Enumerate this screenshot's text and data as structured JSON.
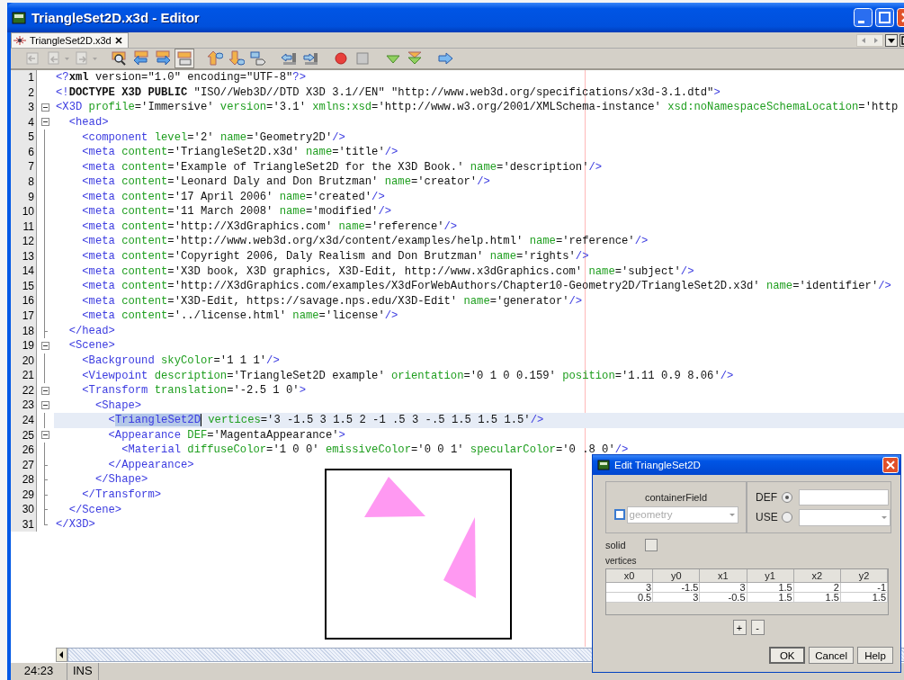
{
  "window": {
    "title": "TriangleSet2D.x3d - Editor"
  },
  "editor_tabs": [
    {
      "label": "TriangleSet2D.x3d",
      "selected": true
    }
  ],
  "toolbar": [
    {
      "disabled": true,
      "pressed": false
    },
    {
      "disabled": true,
      "pressed": false
    },
    {
      "disabled": true,
      "pressed": false
    },
    {
      "disabled": false,
      "pressed": false
    },
    {
      "disabled": false,
      "pressed": false
    },
    {
      "disabled": false,
      "pressed": false
    },
    {
      "disabled": false,
      "pressed": true
    },
    {
      "disabled": false,
      "pressed": false
    },
    {
      "disabled": false,
      "pressed": false
    },
    {
      "disabled": false,
      "pressed": false
    },
    {
      "disabled": false,
      "pressed": false
    },
    {
      "disabled": false,
      "pressed": false
    },
    {
      "disabled": false,
      "pressed": false
    },
    {
      "disabled": false,
      "pressed": false
    },
    {
      "disabled": false,
      "pressed": false
    },
    {
      "disabled": false,
      "pressed": false
    },
    {
      "disabled": false,
      "pressed": false
    }
  ],
  "editor": {
    "lines": [
      {
        "number": "1",
        "kind": "plain",
        "highlighted": false,
        "tokens": [
          {
            "kind": "tag",
            "text": "<?"
          },
          {
            "kind": "keyword",
            "text": "xml"
          },
          {
            "kind": "text",
            "text": " version=\"1.0\" encoding=\"UTF-8\""
          },
          {
            "kind": "tag",
            "text": "?>"
          }
        ]
      },
      {
        "number": "2",
        "kind": "plain",
        "highlighted": false,
        "tokens": [
          {
            "kind": "tag",
            "text": "<!"
          },
          {
            "kind": "keyword",
            "text": "DOCTYPE X3D PUBLIC"
          },
          {
            "kind": "text",
            "text": " \"ISO//Web3D//DTD X3D 3.1//EN\" \"http://www.web3d.org/specifications/x3d-3.1.dtd\""
          },
          {
            "kind": "tag",
            "text": ">"
          }
        ]
      },
      {
        "number": "3",
        "kind": "opener",
        "highlighted": false,
        "tokens": [
          {
            "kind": "tag",
            "text": "<X3D "
          },
          {
            "kind": "attr",
            "text": "profile"
          },
          {
            "kind": "text",
            "text": "='Immersive' "
          },
          {
            "kind": "attr",
            "text": "version"
          },
          {
            "kind": "text",
            "text": "='3.1' "
          },
          {
            "kind": "attr",
            "text": "xmlns:xsd"
          },
          {
            "kind": "text",
            "text": "='http://www.w3.org/2001/XMLSchema-instance' "
          },
          {
            "kind": "attr",
            "text": "xsd:noNamespaceSchemaLocation"
          },
          {
            "kind": "text",
            "text": "='http"
          }
        ]
      },
      {
        "number": "4",
        "kind": "opener",
        "highlighted": false,
        "tokens": [
          {
            "kind": "tag",
            "text": "<head>"
          }
        ]
      },
      {
        "number": "5",
        "kind": "inner",
        "highlighted": false,
        "tokens": [
          {
            "kind": "tag",
            "text": "<component "
          },
          {
            "kind": "attr",
            "text": "level"
          },
          {
            "kind": "text",
            "text": "='2' "
          },
          {
            "kind": "attr",
            "text": "name"
          },
          {
            "kind": "text",
            "text": "='Geometry2D'"
          },
          {
            "kind": "tag",
            "text": "/>"
          }
        ]
      },
      {
        "number": "6",
        "kind": "inner",
        "highlighted": false,
        "tokens": [
          {
            "kind": "tag",
            "text": "<meta "
          },
          {
            "kind": "attr",
            "text": "content"
          },
          {
            "kind": "text",
            "text": "='TriangleSet2D.x3d' "
          },
          {
            "kind": "attr",
            "text": "name"
          },
          {
            "kind": "text",
            "text": "='title'"
          },
          {
            "kind": "tag",
            "text": "/>"
          }
        ]
      },
      {
        "number": "7",
        "kind": "inner",
        "highlighted": false,
        "tokens": [
          {
            "kind": "tag",
            "text": "<meta "
          },
          {
            "kind": "attr",
            "text": "content"
          },
          {
            "kind": "text",
            "text": "='Example of TriangleSet2D for the X3D Book.' "
          },
          {
            "kind": "attr",
            "text": "name"
          },
          {
            "kind": "text",
            "text": "='description'"
          },
          {
            "kind": "tag",
            "text": "/>"
          }
        ]
      },
      {
        "number": "8",
        "kind": "inner",
        "highlighted": false,
        "tokens": [
          {
            "kind": "tag",
            "text": "<meta "
          },
          {
            "kind": "attr",
            "text": "content"
          },
          {
            "kind": "text",
            "text": "='Leonard Daly and Don Brutzman' "
          },
          {
            "kind": "attr",
            "text": "name"
          },
          {
            "kind": "text",
            "text": "='creator'"
          },
          {
            "kind": "tag",
            "text": "/>"
          }
        ]
      },
      {
        "number": "9",
        "kind": "inner",
        "highlighted": false,
        "tokens": [
          {
            "kind": "tag",
            "text": "<meta "
          },
          {
            "kind": "attr",
            "text": "content"
          },
          {
            "kind": "text",
            "text": "='17 April 2006' "
          },
          {
            "kind": "attr",
            "text": "name"
          },
          {
            "kind": "text",
            "text": "='created'"
          },
          {
            "kind": "tag",
            "text": "/>"
          }
        ]
      },
      {
        "number": "10",
        "kind": "inner",
        "highlighted": false,
        "tokens": [
          {
            "kind": "tag",
            "text": "<meta "
          },
          {
            "kind": "attr",
            "text": "content"
          },
          {
            "kind": "text",
            "text": "='11 March 2008' "
          },
          {
            "kind": "attr",
            "text": "name"
          },
          {
            "kind": "text",
            "text": "='modified'"
          },
          {
            "kind": "tag",
            "text": "/>"
          }
        ]
      },
      {
        "number": "11",
        "kind": "inner",
        "highlighted": false,
        "tokens": [
          {
            "kind": "tag",
            "text": "<meta "
          },
          {
            "kind": "attr",
            "text": "content"
          },
          {
            "kind": "text",
            "text": "='http://X3dGraphics.com' "
          },
          {
            "kind": "attr",
            "text": "name"
          },
          {
            "kind": "text",
            "text": "='reference'"
          },
          {
            "kind": "tag",
            "text": "/>"
          }
        ]
      },
      {
        "number": "12",
        "kind": "inner",
        "highlighted": false,
        "tokens": [
          {
            "kind": "tag",
            "text": "<meta "
          },
          {
            "kind": "attr",
            "text": "content"
          },
          {
            "kind": "text",
            "text": "='http://www.web3d.org/x3d/content/examples/help.html' "
          },
          {
            "kind": "attr",
            "text": "name"
          },
          {
            "kind": "text",
            "text": "='reference'"
          },
          {
            "kind": "tag",
            "text": "/>"
          }
        ]
      },
      {
        "number": "13",
        "kind": "inner",
        "highlighted": false,
        "tokens": [
          {
            "kind": "tag",
            "text": "<meta "
          },
          {
            "kind": "attr",
            "text": "content"
          },
          {
            "kind": "text",
            "text": "='Copyright 2006, Daly Realism and Don Brutzman' "
          },
          {
            "kind": "attr",
            "text": "name"
          },
          {
            "kind": "text",
            "text": "='rights'"
          },
          {
            "kind": "tag",
            "text": "/>"
          }
        ]
      },
      {
        "number": "14",
        "kind": "inner",
        "highlighted": false,
        "tokens": [
          {
            "kind": "tag",
            "text": "<meta "
          },
          {
            "kind": "attr",
            "text": "content"
          },
          {
            "kind": "text",
            "text": "='X3D book, X3D graphics, X3D-Edit, http://www.x3dGraphics.com' "
          },
          {
            "kind": "attr",
            "text": "name"
          },
          {
            "kind": "text",
            "text": "='subject'"
          },
          {
            "kind": "tag",
            "text": "/>"
          }
        ]
      },
      {
        "number": "15",
        "kind": "inner",
        "highlighted": false,
        "tokens": [
          {
            "kind": "tag",
            "text": "<meta "
          },
          {
            "kind": "attr",
            "text": "content"
          },
          {
            "kind": "text",
            "text": "='http://X3dGraphics.com/examples/X3dForWebAuthors/Chapter10-Geometry2D/TriangleSet2D.x3d' "
          },
          {
            "kind": "attr",
            "text": "name"
          },
          {
            "kind": "text",
            "text": "='identifier'"
          },
          {
            "kind": "tag",
            "text": "/>"
          }
        ]
      },
      {
        "number": "16",
        "kind": "inner",
        "highlighted": false,
        "tokens": [
          {
            "kind": "tag",
            "text": "<meta "
          },
          {
            "kind": "attr",
            "text": "content"
          },
          {
            "kind": "text",
            "text": "='X3D-Edit, https://savage.nps.edu/X3D-Edit' "
          },
          {
            "kind": "attr",
            "text": "name"
          },
          {
            "kind": "text",
            "text": "='generator'"
          },
          {
            "kind": "tag",
            "text": "/>"
          }
        ]
      },
      {
        "number": "17",
        "kind": "inner",
        "highlighted": false,
        "tokens": [
          {
            "kind": "tag",
            "text": "<meta "
          },
          {
            "kind": "attr",
            "text": "content"
          },
          {
            "kind": "text",
            "text": "='../license.html' "
          },
          {
            "kind": "attr",
            "text": "name"
          },
          {
            "kind": "text",
            "text": "='license'"
          },
          {
            "kind": "tag",
            "text": "/>"
          }
        ]
      },
      {
        "number": "18",
        "kind": "closer",
        "highlighted": false,
        "tokens": [
          {
            "kind": "tag",
            "text": "</head>"
          }
        ]
      },
      {
        "number": "19",
        "kind": "opener",
        "highlighted": false,
        "tokens": [
          {
            "kind": "tag",
            "text": "<Scene>"
          }
        ]
      },
      {
        "number": "20",
        "kind": "inner",
        "highlighted": false,
        "tokens": [
          {
            "kind": "tag",
            "text": "<Background "
          },
          {
            "kind": "attr",
            "text": "skyColor"
          },
          {
            "kind": "text",
            "text": "='1 1 1'"
          },
          {
            "kind": "tag",
            "text": "/>"
          }
        ]
      },
      {
        "number": "21",
        "kind": "inner",
        "highlighted": false,
        "tokens": [
          {
            "kind": "tag",
            "text": "<Viewpoint "
          },
          {
            "kind": "attr",
            "text": "description"
          },
          {
            "kind": "text",
            "text": "='TriangleSet2D example' "
          },
          {
            "kind": "attr",
            "text": "orientation"
          },
          {
            "kind": "text",
            "text": "='0 1 0 0.159' "
          },
          {
            "kind": "attr",
            "text": "position"
          },
          {
            "kind": "text",
            "text": "='1.11 0.9 8.06'"
          },
          {
            "kind": "tag",
            "text": "/>"
          }
        ]
      },
      {
        "number": "22",
        "kind": "opener",
        "highlighted": false,
        "tokens": [
          {
            "kind": "tag",
            "text": "<Transform "
          },
          {
            "kind": "attr",
            "text": "translation"
          },
          {
            "kind": "text",
            "text": "='-2.5 1 0'"
          },
          {
            "kind": "tag",
            "text": ">"
          }
        ]
      },
      {
        "number": "23",
        "kind": "opener",
        "highlighted": false,
        "tokens": [
          {
            "kind": "tag",
            "text": "<Shape>"
          }
        ]
      },
      {
        "number": "24",
        "kind": "inner",
        "highlighted": true,
        "tokens": [
          {
            "kind": "tag",
            "text": "<"
          },
          {
            "kind": "tag",
            "text": "TriangleSet2D",
            "selected": true
          },
          {
            "kind": "attr",
            "text": " vertices"
          },
          {
            "kind": "text",
            "text": "='3 -1.5 3 1.5 2 -1 .5 3 -.5 1.5 1.5 1.5'"
          },
          {
            "kind": "tag",
            "text": "/>"
          }
        ]
      },
      {
        "number": "25",
        "kind": "opener",
        "highlighted": false,
        "tokens": [
          {
            "kind": "tag",
            "text": "<Appearance "
          },
          {
            "kind": "attr",
            "text": "DEF"
          },
          {
            "kind": "text",
            "text": "='MagentaAppearance'"
          },
          {
            "kind": "tag",
            "text": ">"
          }
        ]
      },
      {
        "number": "26",
        "kind": "inner",
        "highlighted": false,
        "tokens": [
          {
            "kind": "tag",
            "text": "<Material "
          },
          {
            "kind": "attr",
            "text": "diffuseColor"
          },
          {
            "kind": "text",
            "text": "='1 0 0' "
          },
          {
            "kind": "attr",
            "text": "emissiveColor"
          },
          {
            "kind": "text",
            "text": "='0 0 1' "
          },
          {
            "kind": "attr",
            "text": "specularColor"
          },
          {
            "kind": "text",
            "text": "='0 .8 0'"
          },
          {
            "kind": "tag",
            "text": "/>"
          }
        ]
      },
      {
        "number": "27",
        "kind": "closer",
        "highlighted": false,
        "tokens": [
          {
            "kind": "tag",
            "text": "</Appearance>"
          }
        ]
      },
      {
        "number": "28",
        "kind": "closer",
        "highlighted": false,
        "tokens": [
          {
            "kind": "tag",
            "text": "</Shape>"
          }
        ]
      },
      {
        "number": "29",
        "kind": "closer",
        "highlighted": false,
        "tokens": [
          {
            "kind": "tag",
            "text": "</Transform>"
          }
        ]
      },
      {
        "number": "30",
        "kind": "closer",
        "highlighted": false,
        "tokens": [
          {
            "kind": "tag",
            "text": "</Scene>"
          }
        ]
      },
      {
        "number": "31",
        "kind": "last",
        "highlighted": false,
        "tokens": [
          {
            "kind": "tag",
            "text": "</X3D>"
          }
        ]
      }
    ]
  },
  "status_bar": {
    "position": "24:23",
    "mode": "INS"
  },
  "dialog": {
    "title": "Edit TriangleSet2D",
    "container_field": {
      "label": "containerField",
      "value": "geometry",
      "checked": false,
      "disabled": true
    },
    "def": {
      "label": "DEF",
      "selected": true
    },
    "use": {
      "label": "USE",
      "selected": false
    },
    "solid": {
      "label": "solid",
      "checked": false
    },
    "vertices": {
      "label": "vertices",
      "columns": [
        "x0",
        "y0",
        "x1",
        "y1",
        "x2",
        "y2"
      ],
      "rows": [
        [
          "3",
          "-1.5",
          "3",
          "1.5",
          "2",
          "-1"
        ],
        [
          "0.5",
          "3",
          "-0.5",
          "1.5",
          "1.5",
          "1.5"
        ]
      ]
    },
    "row_buttons": [
      "+",
      "-"
    ],
    "buttons": [
      {
        "label": "OK",
        "default": true
      },
      {
        "label": "Cancel",
        "default": false
      },
      {
        "label": "Help",
        "default": false
      }
    ]
  }
}
